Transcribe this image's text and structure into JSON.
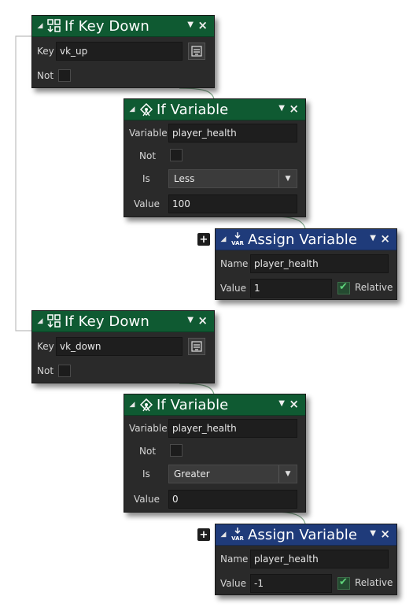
{
  "nodes": {
    "keydown1": {
      "title": "If Key Down",
      "key_label": "Key",
      "key_value": "vk_up",
      "not_label": "Not",
      "not_checked": false
    },
    "ifvar1": {
      "title": "If Variable",
      "variable_label": "Variable",
      "variable_value": "player_health",
      "not_label": "Not",
      "not_checked": false,
      "is_label": "Is",
      "is_value": "Less",
      "value_label": "Value",
      "value_value": "100"
    },
    "assign1": {
      "title": "Assign Variable",
      "name_label": "Name",
      "name_value": "player_health",
      "value_label": "Value",
      "value_value": "1",
      "relative_label": "Relative",
      "relative_checked": true
    },
    "keydown2": {
      "title": "If Key Down",
      "key_label": "Key",
      "key_value": "vk_down",
      "not_label": "Not",
      "not_checked": false
    },
    "ifvar2": {
      "title": "If Variable",
      "variable_label": "Variable",
      "variable_value": "player_health",
      "not_label": "Not",
      "not_checked": false,
      "is_label": "Is",
      "is_value": "Greater",
      "value_label": "Value",
      "value_value": "0"
    },
    "assign2": {
      "title": "Assign Variable",
      "name_label": "Name",
      "name_value": "player_health",
      "value_label": "Value",
      "value_value": "-1",
      "relative_label": "Relative",
      "relative_checked": true
    }
  },
  "icons": {
    "collapse": "collapse-triangle-icon",
    "menu": "dropdown-menu-icon",
    "close": "close-icon",
    "key_node": "key-down-icon",
    "var_node": "if-variable-icon",
    "assign_node": "assign-variable-icon",
    "picker": "key-picker-icon",
    "expand": "plus-icon"
  },
  "glyphs": {
    "collapse": "◢",
    "menu": "▼",
    "close": "×",
    "plus": "+",
    "select_arrow": "▼",
    "var_text": "VAR"
  },
  "colors": {
    "green_header": "#0f5a32",
    "blue_header": "#1f3b7a",
    "node_body": "#2a2a2a",
    "checkmark": "#5fd37b"
  }
}
